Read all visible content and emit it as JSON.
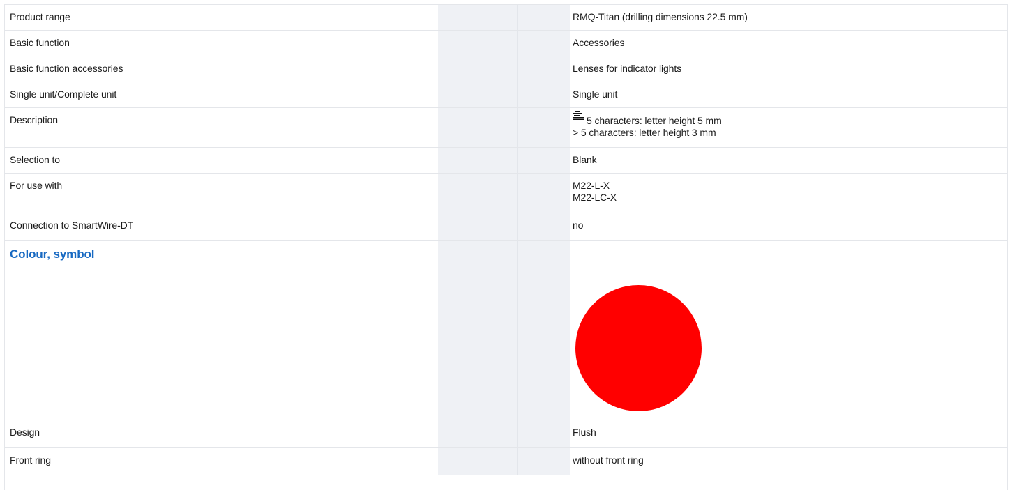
{
  "rows": [
    {
      "label": "Product range",
      "value": "RMQ-Titan (drilling dimensions 22.5 mm)"
    },
    {
      "label": "Basic function",
      "value": "Accessories"
    },
    {
      "label": "Basic function accessories",
      "value": "Lenses for indicator lights"
    },
    {
      "label": "Single unit/Complete unit",
      "value": "Single unit"
    },
    {
      "label": "Description",
      "value_icon": "label-size-icon",
      "value_lines": [
        "5 characters: letter height 5 mm",
        "> 5 characters: letter height 3 mm"
      ]
    },
    {
      "label": "Selection to",
      "value": "Blank"
    },
    {
      "label": "For use with",
      "value_lines": [
        "M22-L-X",
        "M22-LC-X"
      ]
    },
    {
      "label": "Connection to SmartWire-DT",
      "value": "no"
    }
  ],
  "section": {
    "heading": "Colour, symbol"
  },
  "symbol": {
    "name": "red-circle",
    "color": "#ff0000"
  },
  "rows_after": [
    {
      "label": "Design",
      "value": "Flush"
    },
    {
      "label": "Front ring",
      "value": "without front ring"
    }
  ],
  "colors": {
    "heading": "#1769c2",
    "gray_column": "#eff1f5",
    "border": "#e4e6ea"
  }
}
